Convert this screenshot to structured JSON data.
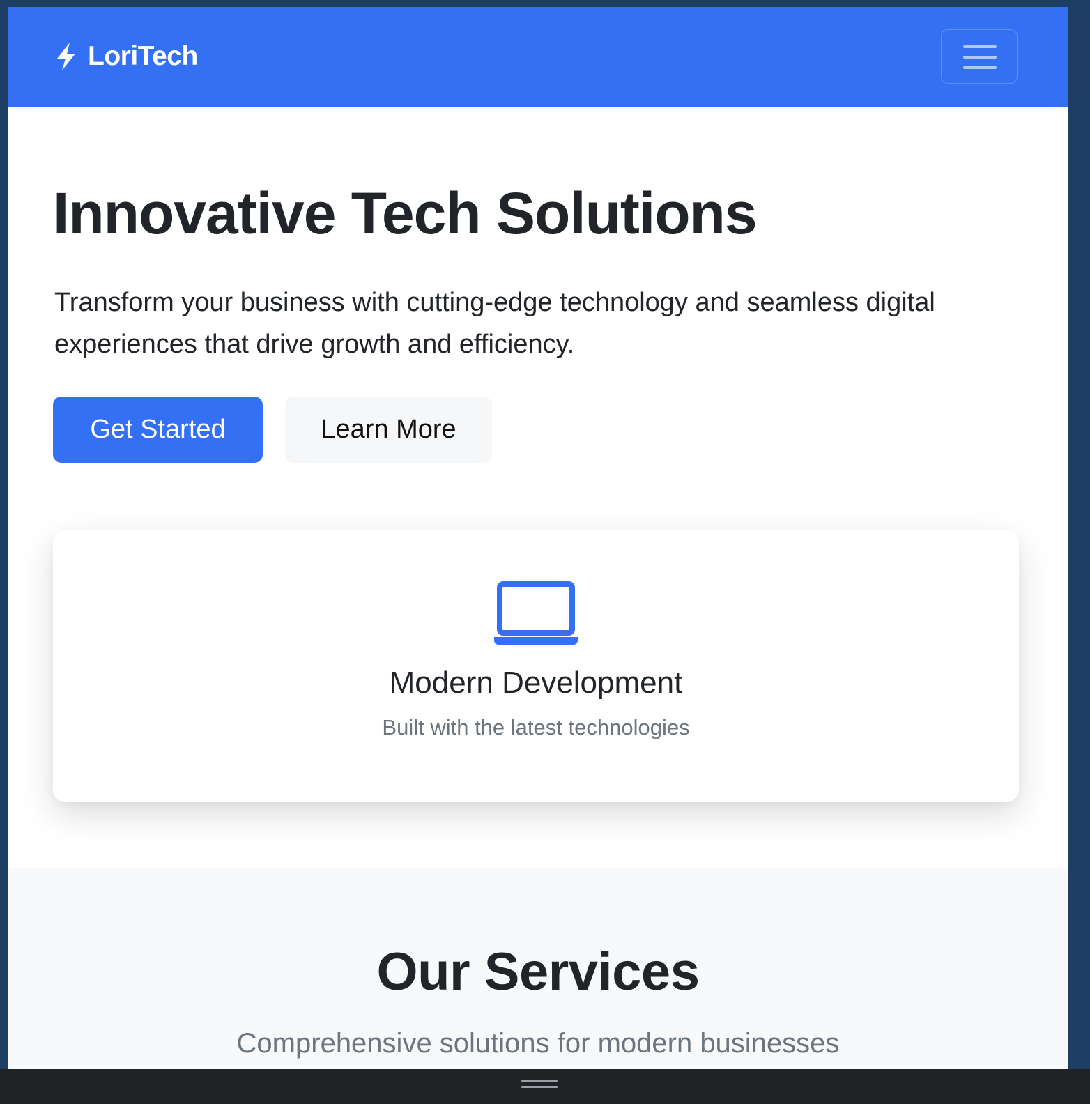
{
  "navbar": {
    "brand_name": "LoriTech",
    "brand_icon": "lightning-bolt-icon",
    "toggler_icon": "hamburger-menu-icon",
    "background_color": "#3370f4"
  },
  "hero": {
    "title": "Innovative Tech Solutions",
    "lead": "Transform your business with cutting-edge technology and seamless digital experiences that drive growth and efficiency.",
    "primary_button": "Get Started",
    "secondary_button": "Learn More"
  },
  "feature_card": {
    "icon": "laptop-icon",
    "title": "Modern Development",
    "text": "Built with the latest technologies"
  },
  "services": {
    "title": "Our Services",
    "subtitle": "Comprehensive solutions for modern businesses"
  },
  "colors": {
    "accent": "#3370f4",
    "heading": "#212529",
    "muted": "#6c757d"
  }
}
